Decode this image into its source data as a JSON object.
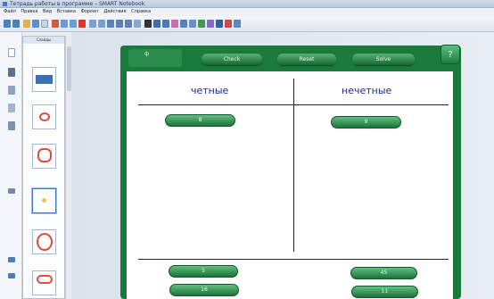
{
  "window": {
    "title": "Тетрадь работы в программе – SMART Notebook"
  },
  "menu": [
    "Файл",
    "Правка",
    "Вид",
    "Вставка",
    "Формат",
    "Действия",
    "Справка"
  ],
  "thumbnail_panel": {
    "header": "Слайды"
  },
  "board": {
    "tabs": {
      "active": "ф",
      "check": "Check",
      "reset": "Reset",
      "solve": "Solve"
    },
    "help": "?",
    "columns": {
      "left": "четные",
      "right": "нечетные"
    },
    "tokens_top": {
      "left": "8",
      "right": "9"
    },
    "tokens_bottom": [
      "5",
      "16",
      "45",
      "11"
    ]
  },
  "colors": {
    "board_green": "#1a7a3e",
    "heading_blue": "#1e2b86"
  }
}
